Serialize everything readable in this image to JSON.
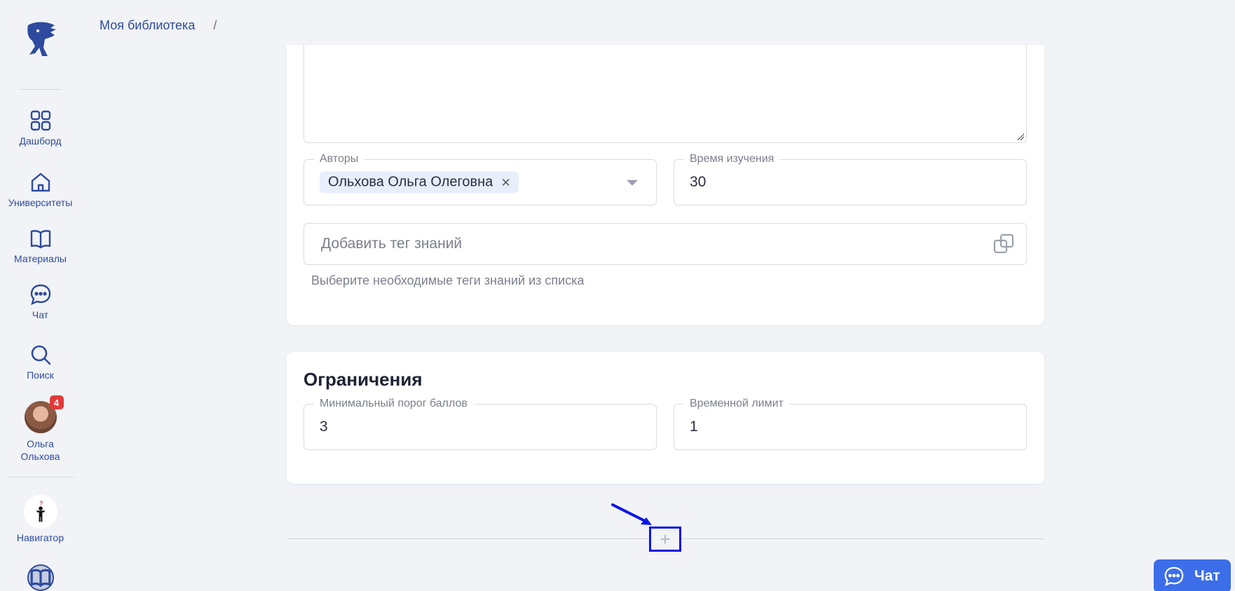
{
  "breadcrumb": {
    "items": [
      "Моя библиотека"
    ],
    "separator": "/"
  },
  "sidebar": {
    "items": [
      {
        "label": "Дашборд",
        "icon": "dashboard-icon"
      },
      {
        "label": "Университеты",
        "icon": "university-icon"
      },
      {
        "label": "Материалы",
        "icon": "book-icon"
      },
      {
        "label": "Чат",
        "icon": "chat-bubble-icon"
      },
      {
        "label": "Поиск",
        "icon": "search-icon"
      }
    ],
    "user": {
      "first_name": "Ольга",
      "last_name": "Ольхова",
      "badge_count": "4"
    },
    "navigator": {
      "label": "Навигатор",
      "mark": "?"
    }
  },
  "form": {
    "authors": {
      "label": "Авторы",
      "chip": "Ольхова Ольга Олеговна",
      "chip_remove": "×"
    },
    "study_time": {
      "label": "Время изучения",
      "value": "30"
    },
    "tags": {
      "placeholder": "Добавить тег знаний",
      "hint": "Выберите необходимые теги знаний из списка"
    }
  },
  "limits": {
    "title": "Ограничения",
    "min_score": {
      "label": "Минимальный порог баллов",
      "value": "3"
    },
    "time_limit": {
      "label": "Временной лимит",
      "value": "1"
    }
  },
  "add_button": {
    "symbol": "+"
  },
  "chat_button": {
    "label": "Чат"
  },
  "colors": {
    "accent": "#2e4a9e",
    "chat": "#3b6ee8",
    "highlight": "#0a16e6",
    "badge": "#e23a3a"
  }
}
